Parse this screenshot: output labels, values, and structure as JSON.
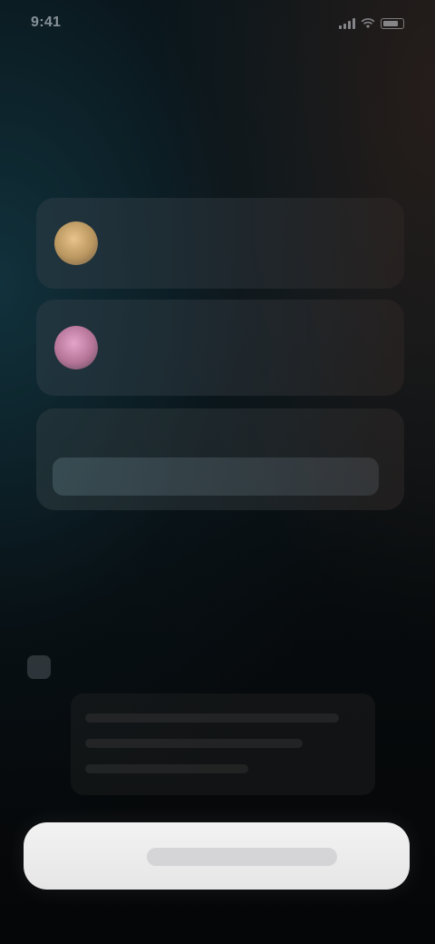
{
  "status_bar": {
    "time": "9:41"
  },
  "header": {
    "eyebrow": "",
    "headline": ""
  },
  "options": [
    {
      "title": "",
      "subtitle": "",
      "icon": "circle-gold-icon",
      "color": "#d8b27a"
    },
    {
      "title": "",
      "subtitle": "",
      "icon": "circle-pink-icon",
      "color": "#d596bb"
    }
  ],
  "info_card": {
    "title": "",
    "body": ""
  },
  "section": {
    "label": "",
    "meta": ""
  },
  "primary_button": {
    "label": ""
  },
  "colors": {
    "accent_green": "#96be78",
    "button_background": "#efefef",
    "background": "#060a0d"
  }
}
